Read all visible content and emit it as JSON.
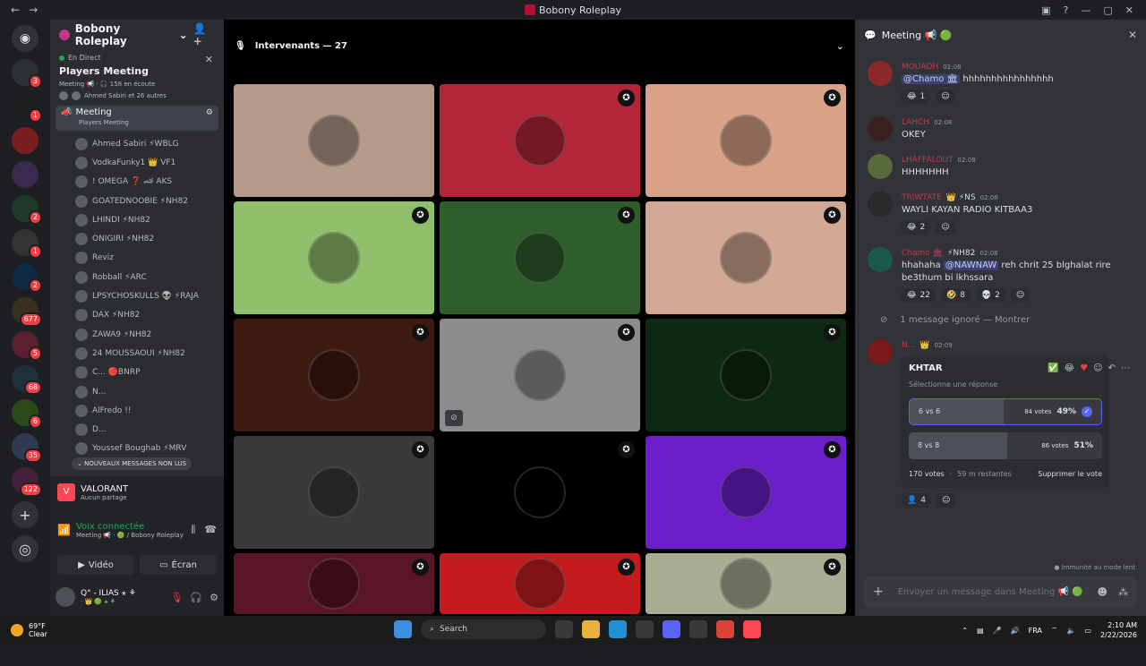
{
  "window": {
    "title": "Bobony Roleplay"
  },
  "rail": {
    "badges": [
      "3",
      "1",
      "",
      "",
      "2",
      "1",
      "2",
      "677",
      "5",
      "68",
      "6",
      "35",
      "122"
    ]
  },
  "sidebar": {
    "guild_name": "Bobony Roleplay",
    "live": {
      "status": "En Direct",
      "name": "Players Meeting",
      "sub": "Meeting 📢 · 🎧 158 en écoute",
      "participants": "Ahmed Sabiri et 26 autres"
    },
    "channel": {
      "name": "Meeting",
      "sub": "Players Meeting"
    },
    "members": [
      "Ahmed Sabiri ⚡WBLG",
      "VodkaFunky1 👑 VF1",
      "! OMEGA ❓ 🏎 AKS",
      "GOATEDNOOBIE ⚡NH82",
      "LHINDI ⚡NH82",
      "ONIGIRI ⚡NH82",
      "Reviz",
      "Robball ⚡ARC",
      "LPSYCHOSKULLS 👽 ⚡RAJA",
      "DAX ⚡NH82",
      "ZAWA9 ⚡NH82",
      "24 MOUSSAOUI ⚡NH82",
      "C... 🔴BNRP",
      "N...",
      "AlFredo !!",
      "D...",
      "Youssef Boughab ⚡MRV"
    ],
    "new_messages": "NOUVEAUX MESSAGES NON LUS",
    "game": {
      "name": "VALORANT",
      "sub": "Aucun partage"
    },
    "voice": {
      "status": "Voix connectée",
      "sub": "Meeting 📢 · 🟢 / Bobony Roleplay"
    },
    "buttons": {
      "video": "Vidéo",
      "screen": "Écran"
    },
    "user": {
      "name": "Q° - ILIAS ⚹ ⚘",
      "status": "· 👑 🟢 ⚹ ⚘"
    }
  },
  "stage": {
    "header": "Intervenants — 27",
    "tiles": [
      {
        "color": "#b59a8a",
        "mod": false
      },
      {
        "color": "#b3263a",
        "mod": true
      },
      {
        "color": "#d9a186",
        "mod": true
      },
      {
        "color": "#8fbf6a",
        "mod": true
      },
      {
        "color": "#2e5f2b",
        "mod": true
      },
      {
        "color": "#d1a891",
        "mod": true
      },
      {
        "color": "#3e1b12",
        "mod": true
      },
      {
        "color": "#8c8c8c",
        "mod": true,
        "hidden": true
      },
      {
        "color": "#0f2a12",
        "mod": true
      },
      {
        "color": "#3a3a3a",
        "mod": true
      },
      {
        "color": "#000000",
        "mod": true
      },
      {
        "color": "#6b1ec9",
        "mod": true
      },
      {
        "color": "#5a1526",
        "mod": true
      },
      {
        "color": "#c41c1c",
        "mod": true
      },
      {
        "color": "#a9ad92",
        "mod": true
      }
    ]
  },
  "chat": {
    "title": "Meeting 📢 🟢",
    "messages": [
      {
        "user": "MOUADH",
        "time": "02:08",
        "mention": "@Chamo 🏛",
        "text": " hhhhhhhhhhhhhhhh",
        "reactions": [
          {
            "emoji": "😂",
            "count": "1"
          }
        ]
      },
      {
        "user": "LAHCH",
        "time": "02:08",
        "text": "OKEY"
      },
      {
        "user": "LHAFFALOUT",
        "time": "02:08",
        "text": "HHHHHHH"
      },
      {
        "user": "TRIWTATE",
        "time": "02:08",
        "tags": "👑 ⚡NS",
        "text": "WAYLI KAYAN RADIO KITBAA3",
        "reactions": [
          {
            "emoji": "😂",
            "count": "2"
          }
        ]
      },
      {
        "user": "Chamo 🏛",
        "time": "02:08",
        "tags": "⚡NH82",
        "text_pre": "hhahaha ",
        "mention": "@NAWNAW",
        "text": " reh chrit 25 blghalat rire be3thum bi lkhssara",
        "reactions": [
          {
            "emoji": "😂",
            "count": "22"
          },
          {
            "emoji": "🤣",
            "count": "8"
          },
          {
            "emoji": "💀",
            "count": "2"
          }
        ]
      }
    ],
    "ignored": {
      "text": "1 message ignoré —",
      "show": "Montrer"
    },
    "poll_msg": {
      "user": "N...",
      "time": "02:09"
    },
    "poll": {
      "question": "KHTAR",
      "hint": "Sélectionne une réponse",
      "options": [
        {
          "label": "6 vs 6",
          "votes": "84 votes",
          "pct": "49%",
          "fraction": 0.49,
          "selected": true
        },
        {
          "label": "8 vs 8",
          "votes": "86 votes",
          "pct": "51%",
          "fraction": 0.51,
          "selected": false
        }
      ],
      "total": "170 votes",
      "remaining": "59 m restantes",
      "remove": "Supprimer le vote"
    },
    "poll_reaction": "4",
    "slowmode": "Immunité au mode lent",
    "composer_placeholder": "Envoyer un message dans Meeting 📢 🟢"
  },
  "taskbar": {
    "weather_temp": "69°F",
    "weather_desc": "Clear",
    "search": "Search",
    "lang": "FRA",
    "time": "2:10 AM",
    "date": "2/22/2026"
  }
}
